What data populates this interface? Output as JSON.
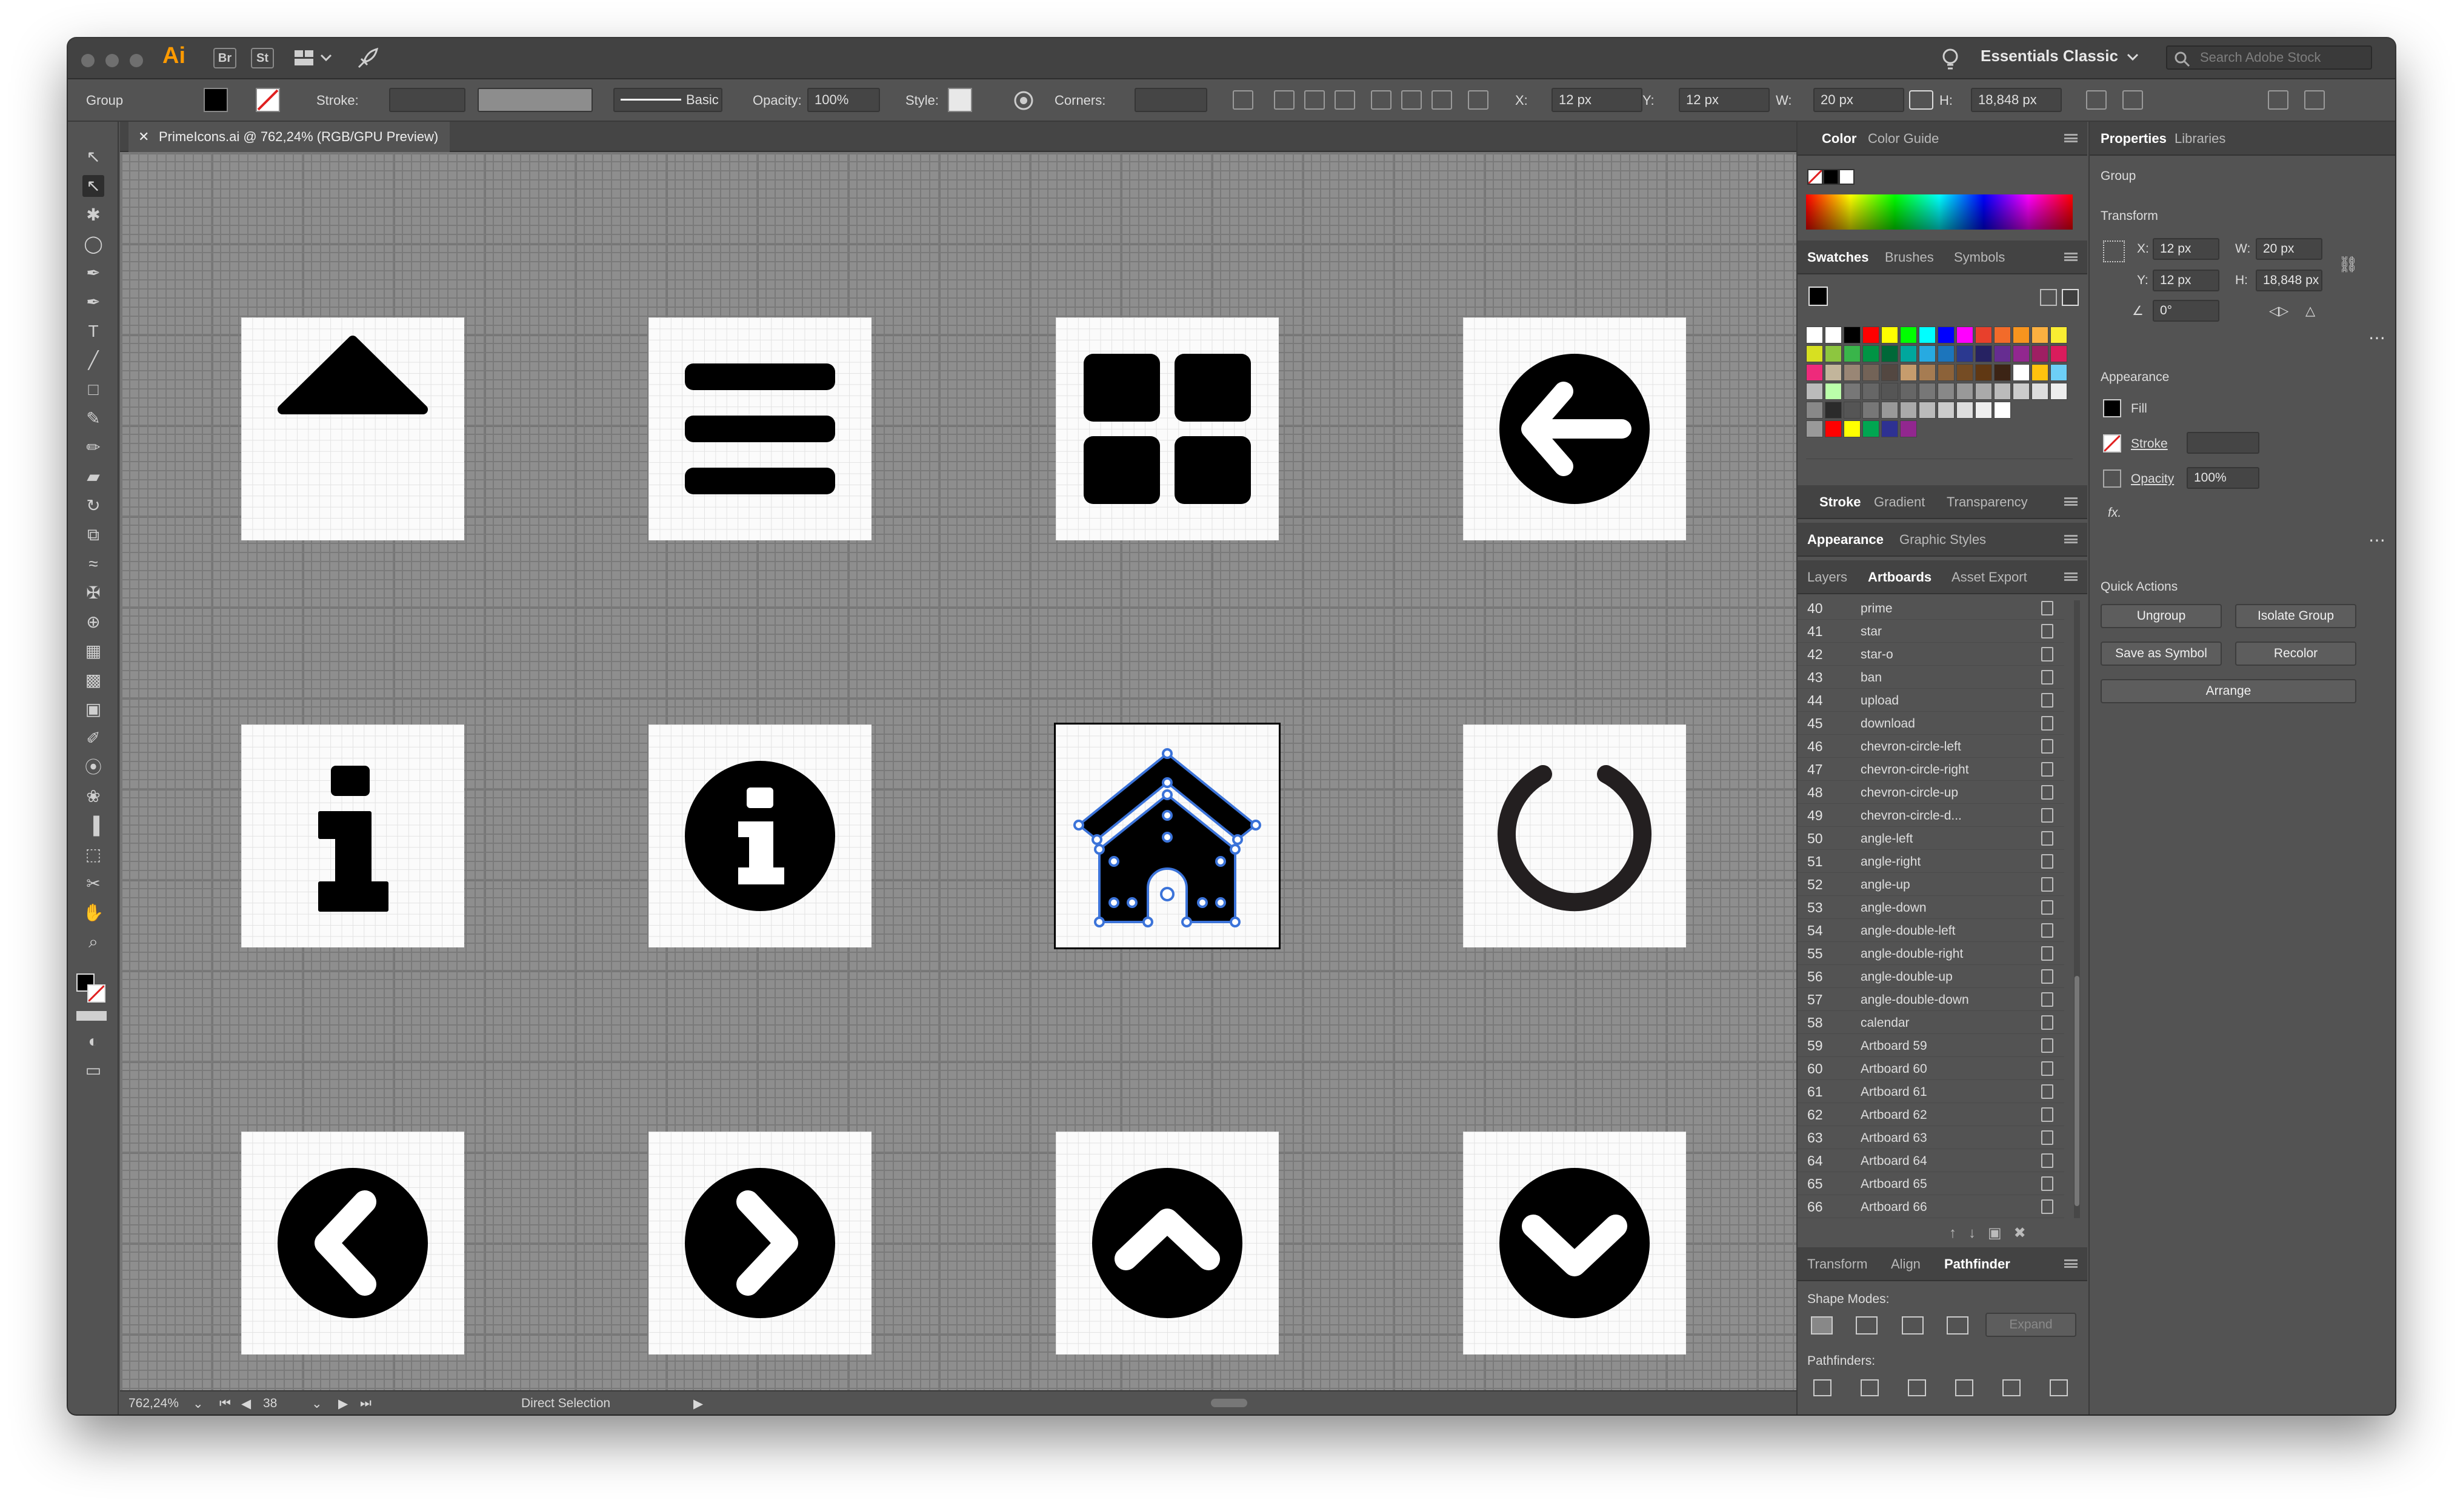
{
  "app": {
    "logo": "Ai",
    "bridge": "Br",
    "stock": "St",
    "workspace": "Essentials Classic",
    "search_placeholder": "Search Adobe Stock"
  },
  "control": {
    "selection": "Group",
    "stroke_label": "Stroke:",
    "brush_label": "Basic",
    "opacity_label": "Opacity:",
    "opacity": "100%",
    "style_label": "Style:",
    "corners_label": "Corners:",
    "x_label": "X:",
    "x": "12 px",
    "y_label": "Y:",
    "y": "12 px",
    "w_label": "W:",
    "w": "20 px",
    "h_label": "H:",
    "h": "18,848 px"
  },
  "document": {
    "tab": "PrimeIcons.ai @ 762,24% (RGB/GPU Preview)"
  },
  "status": {
    "zoom": "762,24%",
    "artboard": "38",
    "tool": "Direct Selection"
  },
  "icons": [
    "triangle-up-icon",
    "bars-icon",
    "th-large-icon",
    "arrow-circle-left-icon",
    "info-icon",
    "info-circle-icon",
    "home-icon",
    "spinner-icon",
    "chevron-circle-left-icon",
    "chevron-circle-right-icon",
    "chevron-circle-up-icon",
    "chevron-circle-down-icon"
  ],
  "color_panel": {
    "tabs": [
      "Color",
      "Color Guide"
    ]
  },
  "swatches_panel": {
    "tabs": [
      "Swatches",
      "Brushes",
      "Symbols"
    ]
  },
  "stroke_panel": {
    "tabs": [
      "Stroke",
      "Gradient",
      "Transparency"
    ]
  },
  "appearance_panel": {
    "tabs": [
      "Appearance",
      "Graphic Styles"
    ]
  },
  "artboards_panel": {
    "tabs": [
      "Layers",
      "Artboards",
      "Asset Export"
    ],
    "rows": [
      {
        "n": "40",
        "name": "prime"
      },
      {
        "n": "41",
        "name": "star"
      },
      {
        "n": "42",
        "name": "star-o"
      },
      {
        "n": "43",
        "name": "ban"
      },
      {
        "n": "44",
        "name": "upload"
      },
      {
        "n": "45",
        "name": "download"
      },
      {
        "n": "46",
        "name": "chevron-circle-left"
      },
      {
        "n": "47",
        "name": "chevron-circle-right"
      },
      {
        "n": "48",
        "name": "chevron-circle-up"
      },
      {
        "n": "49",
        "name": "chevron-circle-d..."
      },
      {
        "n": "50",
        "name": "angle-left"
      },
      {
        "n": "51",
        "name": "angle-right"
      },
      {
        "n": "52",
        "name": "angle-up"
      },
      {
        "n": "53",
        "name": "angle-down"
      },
      {
        "n": "54",
        "name": "angle-double-left"
      },
      {
        "n": "55",
        "name": "angle-double-right"
      },
      {
        "n": "56",
        "name": "angle-double-up"
      },
      {
        "n": "57",
        "name": "angle-double-down"
      },
      {
        "n": "58",
        "name": "calendar"
      },
      {
        "n": "59",
        "name": "Artboard 59"
      },
      {
        "n": "60",
        "name": "Artboard 60"
      },
      {
        "n": "61",
        "name": "Artboard 61"
      },
      {
        "n": "62",
        "name": "Artboard 62"
      },
      {
        "n": "63",
        "name": "Artboard 63"
      },
      {
        "n": "64",
        "name": "Artboard 64"
      },
      {
        "n": "65",
        "name": "Artboard 65"
      },
      {
        "n": "66",
        "name": "Artboard 66"
      }
    ]
  },
  "pathfinder_panel": {
    "tabs": [
      "Transform",
      "Align",
      "Pathfinder"
    ],
    "shape_modes": "Shape Modes:",
    "expand": "Expand",
    "pathfinders": "Pathfinders:"
  },
  "properties": {
    "tabs": [
      "Properties",
      "Libraries"
    ],
    "kind": "Group",
    "transform_title": "Transform",
    "x_label": "X:",
    "x": "12 px",
    "w_label": "W:",
    "w": "20 px",
    "y_label": "Y:",
    "y": "12 px",
    "h_label": "H:",
    "h": "18,848 px",
    "angle": "0°",
    "appearance_title": "Appearance",
    "fill_label": "Fill",
    "stroke_label": "Stroke",
    "opacity_label": "Opacity",
    "opacity": "100%",
    "fx": "fx.",
    "quick_actions_title": "Quick Actions",
    "ungroup": "Ungroup",
    "isolate": "Isolate Group",
    "save_symbol": "Save as Symbol",
    "recolor": "Recolor",
    "arrange": "Arrange"
  },
  "colors": {
    "accent": "#3b73d9",
    "ui_bg": "#535353",
    "logo": "#ff9a00"
  }
}
